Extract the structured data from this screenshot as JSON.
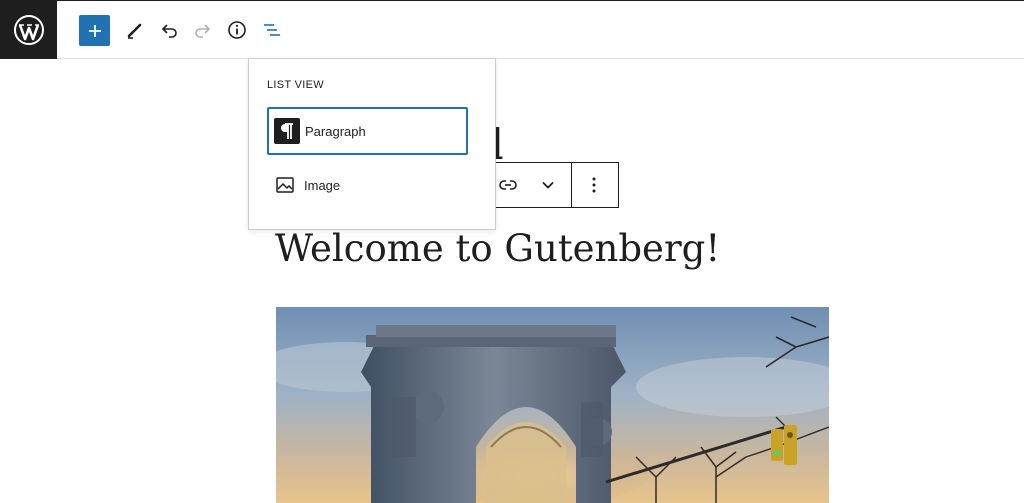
{
  "toolbar": {
    "logo_icon": "wordpress-logo-icon",
    "add_block_icon": "plus-icon",
    "tools_icon": "pencil-icon",
    "undo_icon": "undo-icon",
    "redo_icon": "redo-icon",
    "details_icon": "info-icon",
    "list_view_icon": "list-view-icon",
    "accent_color": "#2271b1"
  },
  "list_view": {
    "title": "List View",
    "items": [
      {
        "label": "Paragraph",
        "icon": "paragraph-icon",
        "selected": true
      },
      {
        "label": "Image",
        "icon": "image-icon",
        "selected": false
      }
    ]
  },
  "editor": {
    "title_fragment": "d",
    "heading": "Welcome to Gutenberg!",
    "block_toolbar": {
      "link_icon": "link-icon",
      "more_options_icon": "chevron-down-icon",
      "options_icon": "vertical-ellipsis-icon"
    },
    "image_block": {
      "subject": "arch-photo"
    }
  }
}
